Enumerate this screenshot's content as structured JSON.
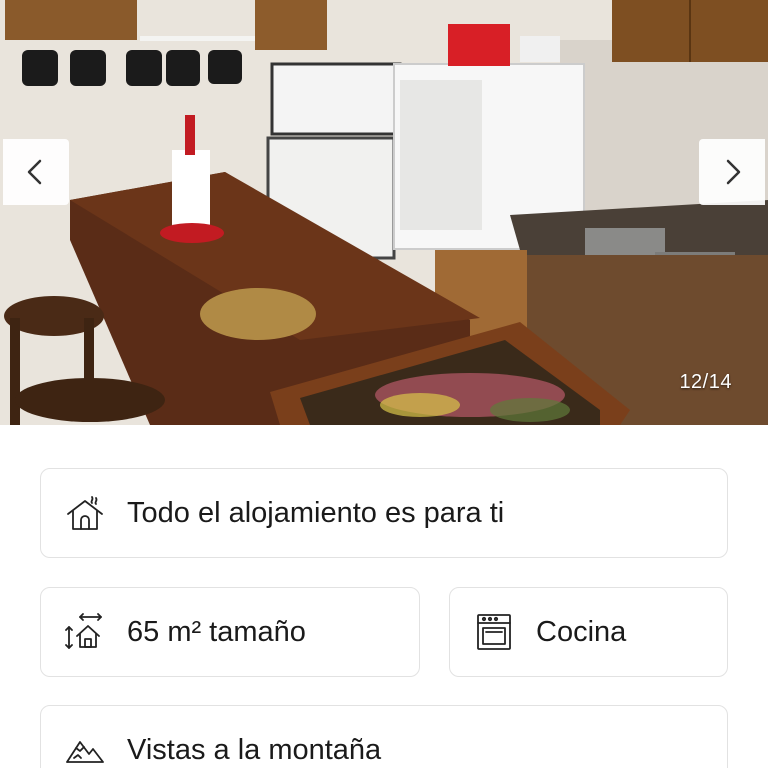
{
  "gallery": {
    "counter": "12/14",
    "prev_icon": "chevron-left-icon",
    "next_icon": "chevron-right-icon"
  },
  "features": {
    "whole_place": {
      "label": "Todo el alojamiento es para ti",
      "icon": "house-icon"
    },
    "size": {
      "label": "65 m² tamaño",
      "icon": "area-size-icon"
    },
    "kitchen": {
      "label": "Cocina",
      "icon": "oven-icon"
    },
    "view": {
      "label": "Vistas a la montaña",
      "icon": "mountain-icon"
    }
  }
}
